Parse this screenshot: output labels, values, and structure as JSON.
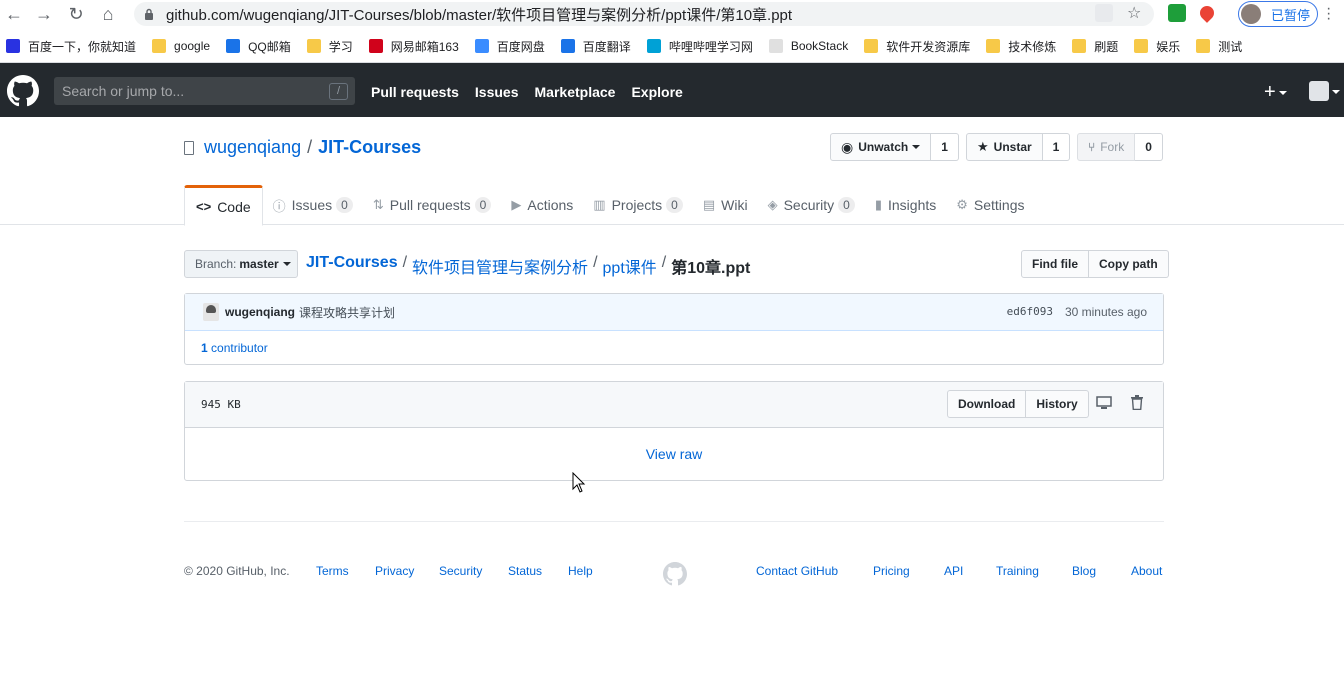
{
  "browser": {
    "url": "github.com/wugenqiang/JIT-Courses/blob/master/软件项目管理与案例分析/ppt课件/第10章.ppt",
    "profile_label": "已暂停",
    "bookmarks": [
      {
        "label": "百度一下，你就知道",
        "icon": "baidu-icon",
        "color": "#2932e1"
      },
      {
        "label": "google",
        "icon": "folder-icon",
        "color": "#f7c948"
      },
      {
        "label": "QQ邮箱",
        "icon": "qqmail-icon",
        "color": "#1a73e8"
      },
      {
        "label": "学习",
        "icon": "folder-icon",
        "color": "#f7c948"
      },
      {
        "label": "网易邮箱163",
        "icon": "netease-icon",
        "color": "#d0021b"
      },
      {
        "label": "百度网盘",
        "icon": "baidupan-icon",
        "color": "#3a8cff"
      },
      {
        "label": "百度翻译",
        "icon": "baidufanyi-icon",
        "color": "#1a73e8"
      },
      {
        "label": "哔哩哔哩学习网",
        "icon": "bilibili-icon",
        "color": "#00a1d6"
      },
      {
        "label": "BookStack",
        "icon": "bookstack-icon",
        "color": "#e0e0e0"
      },
      {
        "label": "软件开发资源库",
        "icon": "folder-icon",
        "color": "#f7c948"
      },
      {
        "label": "技术修炼",
        "icon": "folder-icon",
        "color": "#f7c948"
      },
      {
        "label": "刷题",
        "icon": "folder-icon",
        "color": "#f7c948"
      },
      {
        "label": "娱乐",
        "icon": "folder-icon",
        "color": "#f7c948"
      },
      {
        "label": "测试",
        "icon": "folder-icon",
        "color": "#f7c948"
      }
    ]
  },
  "header": {
    "search_placeholder": "Search or jump to...",
    "search_hotkey": "/",
    "nav": [
      "Pull requests",
      "Issues",
      "Marketplace",
      "Explore"
    ],
    "plus": "+"
  },
  "repo": {
    "owner": "wugenqiang",
    "separator": "/",
    "name": "JIT-Courses",
    "watch": {
      "label": "Unwatch",
      "count": "1"
    },
    "star": {
      "label": "Unstar",
      "count": "1"
    },
    "fork": {
      "label": "Fork",
      "count": "0"
    }
  },
  "tabs": [
    {
      "label": "Code",
      "icon": "code-icon"
    },
    {
      "label": "Issues",
      "icon": "issue-icon",
      "count": "0"
    },
    {
      "label": "Pull requests",
      "icon": "pr-icon",
      "count": "0"
    },
    {
      "label": "Actions",
      "icon": "play-icon"
    },
    {
      "label": "Projects",
      "icon": "project-icon",
      "count": "0"
    },
    {
      "label": "Wiki",
      "icon": "book-icon"
    },
    {
      "label": "Security",
      "icon": "shield-icon",
      "count": "0"
    },
    {
      "label": "Insights",
      "icon": "graph-icon"
    },
    {
      "label": "Settings",
      "icon": "gear-icon"
    }
  ],
  "file_nav": {
    "branch_key": "Branch:",
    "branch_value": "master",
    "crumbs": [
      "JIT-Courses",
      "软件项目管理与案例分析",
      "ppt课件"
    ],
    "current": "第10章.ppt",
    "find_file": "Find file",
    "copy_path": "Copy path"
  },
  "commit": {
    "author": "wugenqiang",
    "message": "课程攻略共享计划",
    "sha": "ed6f093",
    "time": "30 minutes ago",
    "contributors_count": "1",
    "contributors_label": "contributor"
  },
  "file": {
    "size": "945 KB",
    "download": "Download",
    "history": "History",
    "view_raw": "View raw"
  },
  "footer": {
    "copyright": "© 2020 GitHub, Inc.",
    "left_links": [
      "Terms",
      "Privacy",
      "Security",
      "Status",
      "Help"
    ],
    "right_links": [
      "Contact GitHub",
      "Pricing",
      "API",
      "Training",
      "Blog",
      "About"
    ]
  }
}
